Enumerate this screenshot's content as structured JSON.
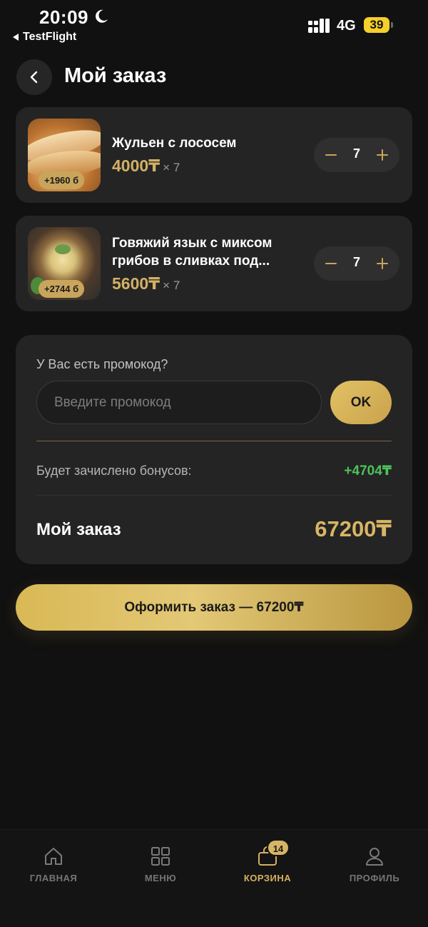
{
  "status_bar": {
    "time": "20:09",
    "back_app": "TestFlight",
    "network": "4G",
    "battery": "39"
  },
  "header": {
    "title": "Мой заказ",
    "back_icon": "chevron-left-icon"
  },
  "cart_items": [
    {
      "name": "Жульен с лососем",
      "price": "4000₸",
      "multiplier": "× 7",
      "quantity": "7",
      "bonus": "+1960 б"
    },
    {
      "name": "Говяжий язык с миксом грибов в сливках под...",
      "price": "5600₸",
      "multiplier": "× 7",
      "quantity": "7",
      "bonus": "+2744 б"
    }
  ],
  "promo": {
    "label": "У Вас есть промокод?",
    "placeholder": "Введите промокод",
    "value": "",
    "button": "OK"
  },
  "summary": {
    "bonus_label": "Будет зачислено бонусов:",
    "bonus_value": "+4704₸",
    "total_label": "Мой заказ",
    "total_value": "67200₸"
  },
  "checkout": {
    "label": "Оформить заказ — 67200₸"
  },
  "bottom_nav": {
    "items": [
      {
        "label": "ГЛАВНАЯ",
        "icon": "home-icon"
      },
      {
        "label": "МЕНЮ",
        "icon": "grid-icon"
      },
      {
        "label": "КОРЗИНА",
        "icon": "bag-icon",
        "badge": "14",
        "active": true
      },
      {
        "label": "ПРОФИЛЬ",
        "icon": "user-icon"
      }
    ]
  },
  "colors": {
    "background": "#111111",
    "card": "#242424",
    "accent_gold": "#d8b565",
    "bonus_green": "#4cc35a"
  }
}
